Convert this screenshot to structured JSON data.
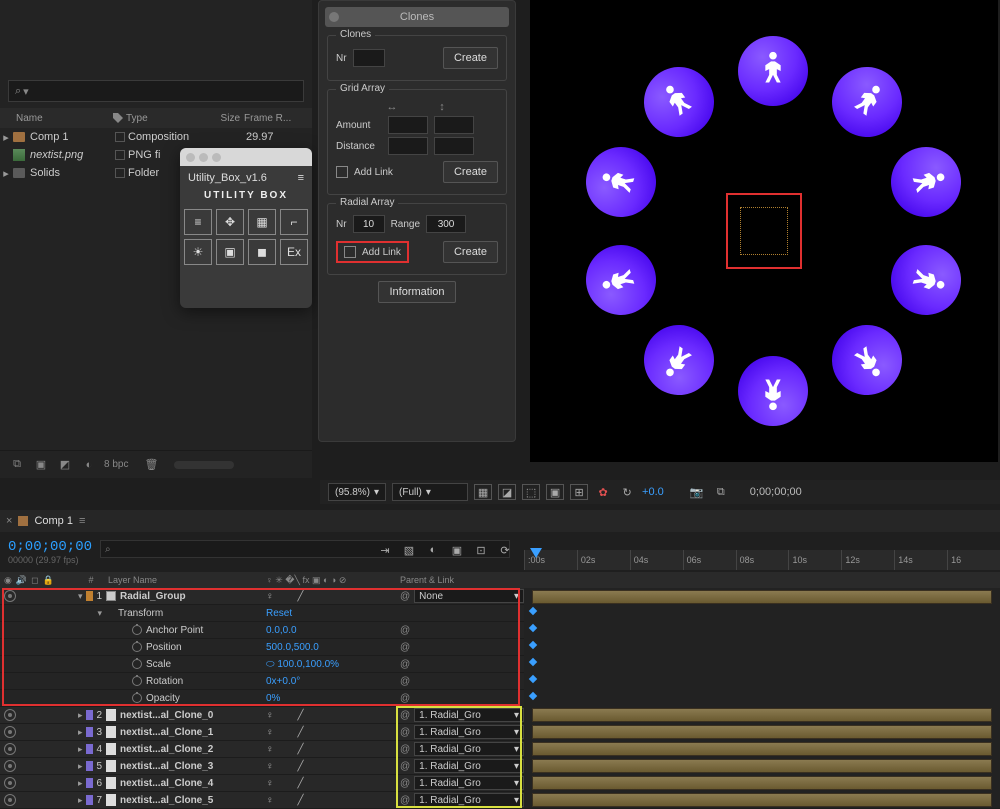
{
  "project": {
    "search_placeholder": "⌕",
    "cols": {
      "name": "Name",
      "type": "Type",
      "size": "Size",
      "fps": "Frame R..."
    },
    "rows": [
      {
        "name": "Comp 1",
        "type": "Composition",
        "fps": "29.97",
        "kind": "comp",
        "expandable": true
      },
      {
        "name": "nextist.png",
        "type": "PNG fi",
        "kind": "png",
        "italic": true
      },
      {
        "name": "Solids",
        "type": "Folder",
        "kind": "folder",
        "expandable": true
      }
    ],
    "footer_bpc": "8 bpc"
  },
  "utility": {
    "title": "Utility_Box_v1.6",
    "brand": "UTILITY BOX",
    "icons": [
      "align-icon",
      "anchor-icon",
      "grid-icon",
      "corner-icon",
      "sun-icon",
      "boxes-icon",
      "camera-icon",
      "ex-icon"
    ],
    "glyphs": [
      "≡",
      "✥",
      "▦",
      "⌐",
      "☀",
      "▣",
      "◼",
      "Ex"
    ]
  },
  "clones_panel": {
    "title": "Clones",
    "clones": {
      "legend": "Clones",
      "nr_label": "Nr",
      "create": "Create"
    },
    "grid": {
      "legend": "Grid Array",
      "amount_label": "Amount",
      "distance_label": "Distance",
      "addlink_label": "Add Link",
      "create": "Create"
    },
    "radial": {
      "legend": "Radial Array",
      "nr_label": "Nr",
      "nr_value": "10",
      "range_label": "Range",
      "range_value": "300",
      "addlink_label": "Add Link",
      "create": "Create"
    },
    "info_btn": "Information"
  },
  "comp_footer": {
    "zoom": "(95.8%)",
    "res": "(Full)",
    "exposure": "+0.0",
    "timecode": "0;00;00;00"
  },
  "timeline": {
    "tab_name": "Comp 1",
    "timecode": "0;00;00;00",
    "subtc": "00000 (29.97 fps)",
    "search_placeholder": "⌕",
    "ruler": [
      ":00s",
      "02s",
      "04s",
      "06s",
      "08s",
      "10s",
      "12s",
      "14s",
      "16"
    ],
    "cols": {
      "hash": "#",
      "layer": "Layer Name",
      "switches": "♀ ✳ �╲ fx ▣ ◐ ◑ ⊘",
      "parent": "Parent & Link"
    },
    "group_layer": {
      "num": "1",
      "name": "Radial_Group",
      "parent": "None",
      "transform_label": "Transform",
      "reset": "Reset",
      "props": [
        {
          "label": "Anchor Point",
          "value": "0.0,0.0"
        },
        {
          "label": "Position",
          "value": "500.0,500.0"
        },
        {
          "label": "Scale",
          "value": "100.0,100.0%",
          "linked": true
        },
        {
          "label": "Rotation",
          "value": "0x+0.0°"
        },
        {
          "label": "Opacity",
          "value": "0%"
        }
      ]
    },
    "clone_layers": [
      {
        "num": "2",
        "name": "nextist...al_Clone_0",
        "parent": "1. Radial_Gro"
      },
      {
        "num": "3",
        "name": "nextist...al_Clone_1",
        "parent": "1. Radial_Gro"
      },
      {
        "num": "4",
        "name": "nextist...al_Clone_2",
        "parent": "1. Radial_Gro"
      },
      {
        "num": "5",
        "name": "nextist...al_Clone_3",
        "parent": "1. Radial_Gro"
      },
      {
        "num": "6",
        "name": "nextist...al_Clone_4",
        "parent": "1. Radial_Gro"
      },
      {
        "num": "7",
        "name": "nextist...al_Clone_5",
        "parent": "1. Radial_Gro"
      }
    ]
  }
}
